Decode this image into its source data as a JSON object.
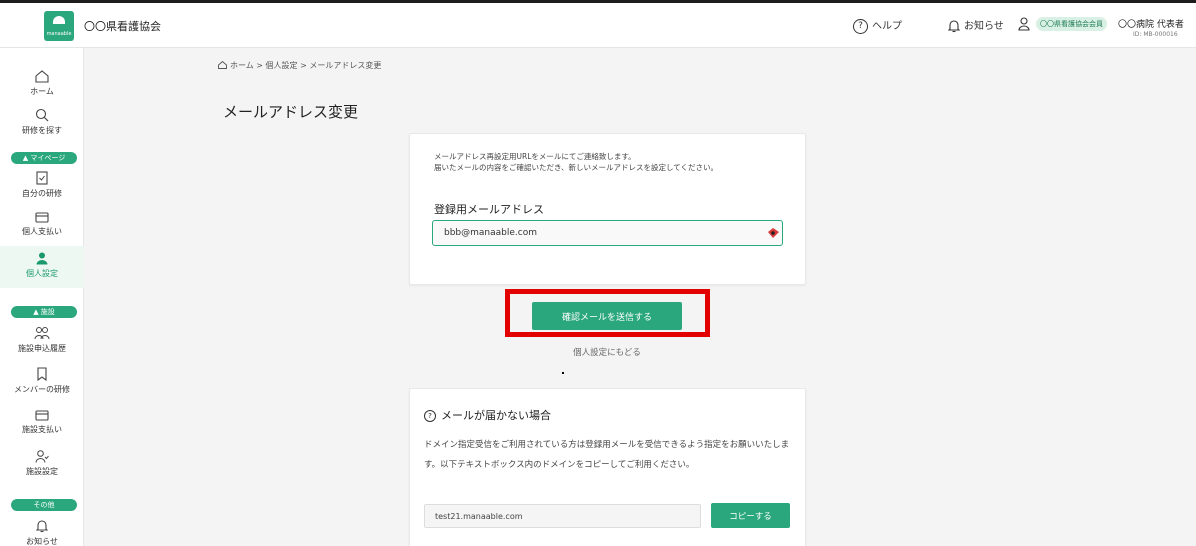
{
  "header": {
    "logo_text": "manaable",
    "org_name": "〇〇県看護協会",
    "help_label": "ヘルプ",
    "help_icon": "?",
    "news_label": "お知らせ",
    "member_badge": "〇〇県看護協会会員",
    "user_name": "〇〇病院 代表者",
    "user_id": "ID: MB-000016"
  },
  "sidebar": {
    "home": "ホーム",
    "search": "研修を探す",
    "mypage_section": "▲ マイページ",
    "my_trainings": "自分の研修",
    "personal_payment": "個人支払い",
    "personal_settings": "個人設定",
    "facility_section": "▲ 施設",
    "facility_history": "施設申込履歴",
    "member_trainings": "メンバーの研修",
    "facility_payment": "施設支払い",
    "facility_settings": "施設設定",
    "other_section": "その他",
    "notifications": "お知らせ"
  },
  "breadcrumb": "ホーム > 個人設定 > メールアドレス変更",
  "page_title": "メールアドレス変更",
  "form": {
    "desc_line1": "メールアドレス再設定用URLをメールにてご連絡致します。",
    "desc_line2": "届いたメールの内容をご確認いただき、新しいメールアドレスを設定してください。",
    "email_label": "登録用メールアドレス",
    "email_value": "bbb@manaable.com"
  },
  "send_button": "確認メールを送信する",
  "back_link": "個人設定にもどる",
  "notice": {
    "icon": "?",
    "title": "メールが届かない場合",
    "body": "ドメイン指定受信をご利用されている方は登録用メールを受信できるよう指定をお願いいたします。以下テキストボックス内のドメインをコピーしてご利用ください。",
    "domain_value": "test21.manaable.com",
    "copy_button": "コピーする"
  },
  "colors": {
    "accent": "#2aa77c",
    "highlight": "#e30000"
  }
}
